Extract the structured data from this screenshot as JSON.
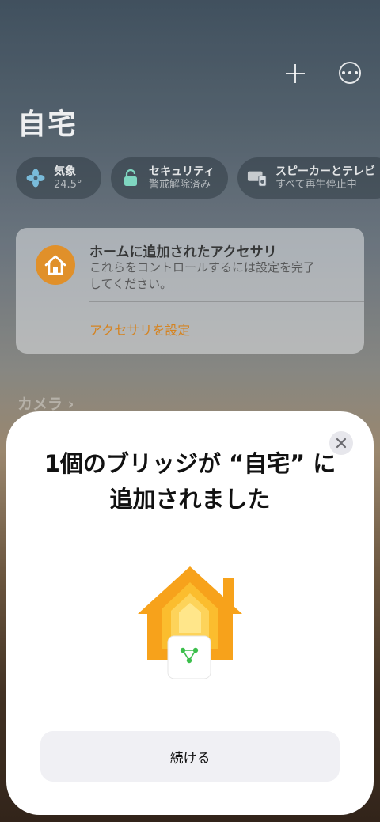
{
  "header": {
    "title": "自宅",
    "add_icon": "plus-icon",
    "more_icon": "ellipsis-circle-icon"
  },
  "status_chips": [
    {
      "title": "気象",
      "value": "24.5°",
      "icon": "fan-icon"
    },
    {
      "title": "セキュリティ",
      "value": "警戒解除済み",
      "icon": "lock-icon"
    },
    {
      "title": "スピーカーとテレビ",
      "value": "すべて再生停止中",
      "icon": "tv-speaker-icon"
    }
  ],
  "accessory_card": {
    "title": "ホームに追加されたアクセサリ",
    "description": "これらをコントロールするには設定を完了してください。",
    "link": "アクセサリを設定",
    "icon": "home-icon"
  },
  "camera_section": {
    "title": "カメラ"
  },
  "modal": {
    "title": "1個のブリッジが “自宅” に追加されました",
    "button": "続ける",
    "close_icon": "close-icon",
    "illustration": "home-bridge-icon"
  },
  "colors": {
    "accent": "#d58320",
    "house_outer": "#f7a21b",
    "bridge_green": "#3cbf4c"
  }
}
